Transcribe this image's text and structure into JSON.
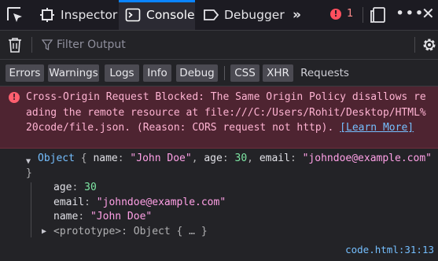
{
  "toolbar": {
    "tabs": [
      {
        "label": "Inspector"
      },
      {
        "label": "Console",
        "selected": true
      },
      {
        "label": "Debugger"
      }
    ],
    "error_count": "1",
    "icons": [
      "element-picker-icon",
      "inspector-icon",
      "console-icon",
      "debugger-icon",
      "overflow-chevrons-icon",
      "error-icon",
      "dock-side-icon",
      "more-options-icon",
      "close-icon"
    ]
  },
  "filter": {
    "placeholder": "Filter Output",
    "value": ""
  },
  "levels": [
    {
      "label": "Errors",
      "active": true
    },
    {
      "label": "Warnings",
      "active": true
    },
    {
      "label": "Logs",
      "active": true
    },
    {
      "label": "Info",
      "active": true
    },
    {
      "label": "Debug",
      "active": true
    },
    {
      "label": "CSS",
      "active": true
    },
    {
      "label": "XHR",
      "active": true
    },
    {
      "label": "Requests",
      "active": false
    }
  ],
  "error_message": {
    "text": "Cross-Origin Request Blocked: The Same Origin Policy disallows reading the remote resource at file:///C:/Users/Rohit/Desktop/HTML%20code/file.json. (Reason: CORS request not http). ",
    "link": "[Learn More]"
  },
  "object_log": {
    "header": {
      "type": "Object",
      "open": " { ",
      "k1": "name",
      "v1": "\"John Doe\"",
      "k2": "age",
      "v2": "30",
      "k3": "email",
      "v3": "\"johndoe@example.com\"",
      "close": " }"
    },
    "properties": [
      {
        "key": "age",
        "value": "30",
        "kind": "number"
      },
      {
        "key": "email",
        "value": "\"johndoe@example.com\"",
        "kind": "string"
      },
      {
        "key": "name",
        "value": "\"John Doe\"",
        "kind": "string"
      }
    ],
    "prototype": "<prototype>: Object { … }",
    "source": "code.html:31:13"
  },
  "colors": {
    "accent": "#0a84ff",
    "error_bg": "#4e2431",
    "error_text": "#ffb3d2",
    "link": "#75bfff",
    "string": "#ffa0e6",
    "number": "#7ee7a4"
  }
}
